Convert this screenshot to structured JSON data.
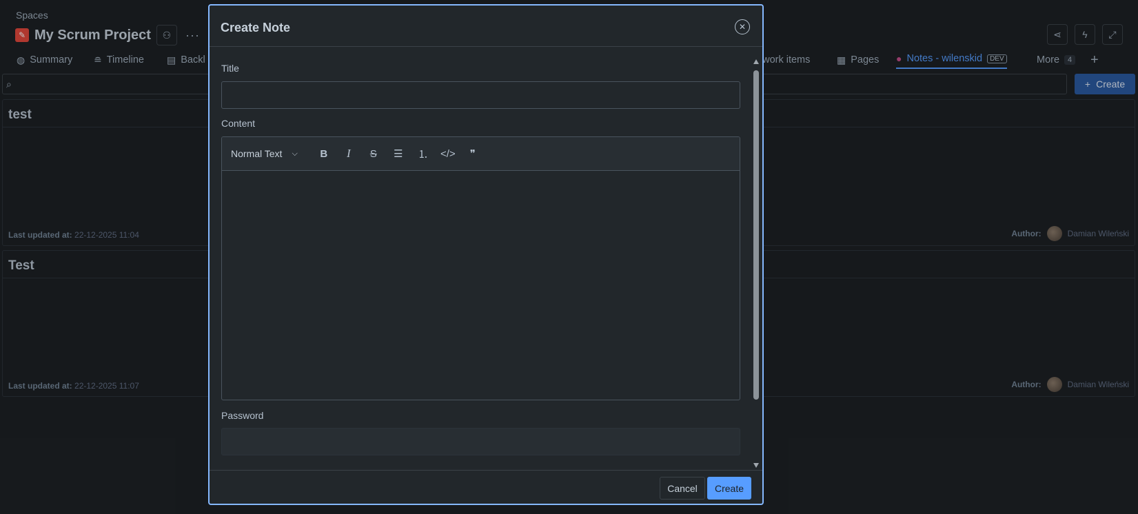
{
  "page": {
    "breadcrumb": "Spaces",
    "project_title": "My Scrum Project",
    "tabs": {
      "summary": "Summary",
      "timeline": "Timeline",
      "backlog": "Backl",
      "archived": "d work items",
      "pages": "Pages",
      "notes": "Notes - wilenskid",
      "notes_badge": "DEV",
      "more": "More",
      "more_count": "4"
    },
    "create_label": "Create",
    "notes": [
      {
        "title": "test",
        "updated_label": "Last updated at:",
        "updated_value": "22-12-2025 11:04",
        "author_label": "Author:",
        "author_name": "Damian Wileński"
      },
      {
        "title": "Test",
        "updated_label": "Last updated at:",
        "updated_value": "22-12-2025 11:07",
        "author_label": "Author:",
        "author_name": "Damian Wileński"
      }
    ]
  },
  "modal": {
    "title": "Create Note",
    "title_label": "Title",
    "title_value": "",
    "content_label": "Content",
    "text_style": "Normal Text",
    "password_label": "Password",
    "password_value": "",
    "cancel_label": "Cancel",
    "create_label": "Create"
  },
  "colors": {
    "accent": "#579dff",
    "background": "#1d2125",
    "modal_border": "#85b8ff"
  }
}
